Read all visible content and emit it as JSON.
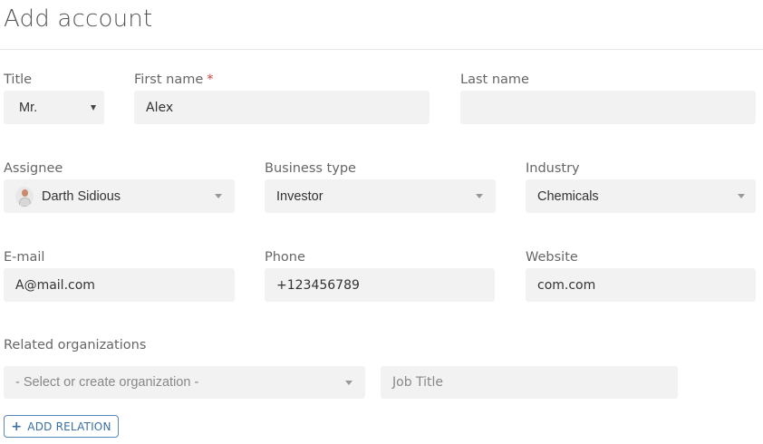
{
  "page": {
    "title": "Add account"
  },
  "fields": {
    "title": {
      "label": "Title",
      "value": "Mr."
    },
    "first_name": {
      "label": "First name",
      "required_mark": "*",
      "value": "Alex"
    },
    "last_name": {
      "label": "Last name",
      "value": ""
    },
    "assignee": {
      "label": "Assignee",
      "value": "Darth Sidious",
      "avatar_icon": "user-avatar"
    },
    "business_type": {
      "label": "Business type",
      "value": "Investor"
    },
    "industry": {
      "label": "Industry",
      "value": "Chemicals"
    },
    "email": {
      "label": "E-mail",
      "value": "A@mail.com"
    },
    "phone": {
      "label": "Phone",
      "value": "+123456789"
    },
    "website": {
      "label": "Website",
      "value": "com.com"
    }
  },
  "related": {
    "label": "Related organizations",
    "organization_placeholder": "- Select or create organization -",
    "job_title_placeholder": "Job Title",
    "add_button_icon": "plus-icon",
    "add_button_label": "ADD RELATION"
  },
  "colors": {
    "field_background": "#f2f2f2",
    "required_mark": "#d0433a",
    "button_accent": "#3b6ea5"
  }
}
